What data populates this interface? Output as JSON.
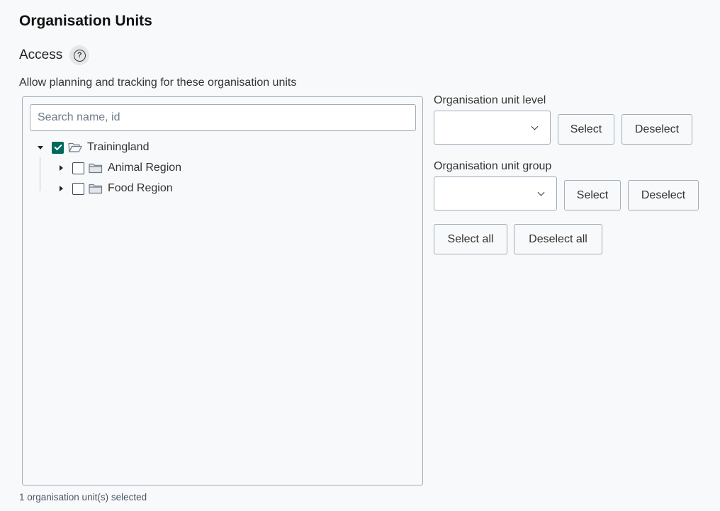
{
  "section": {
    "title": "Organisation Units",
    "access_label": "Access",
    "help_icon": "question-circle-icon",
    "help_text": "Allow planning and tracking for these organisation units"
  },
  "tree": {
    "search_placeholder": "Search name, id",
    "root": {
      "label": "Trainingland",
      "checked": true,
      "expanded": true,
      "icon": "folder-open-icon"
    },
    "children": [
      {
        "label": "Animal Region",
        "checked": false,
        "expanded": false,
        "icon": "folder-icon"
      },
      {
        "label": "Food Region",
        "checked": false,
        "expanded": false,
        "icon": "folder-icon"
      }
    ]
  },
  "level": {
    "label": "Organisation unit level",
    "value": "",
    "select_label": "Select",
    "deselect_label": "Deselect"
  },
  "group": {
    "label": "Organisation unit group",
    "value": "",
    "select_label": "Select",
    "deselect_label": "Deselect"
  },
  "bulk": {
    "select_all_label": "Select all",
    "deselect_all_label": "Deselect all"
  },
  "status": {
    "selected_text": "1 organisation unit(s) selected"
  },
  "colors": {
    "checkbox_checked": "#00695c",
    "background": "#f8f9fa",
    "border": "#a0adba"
  }
}
